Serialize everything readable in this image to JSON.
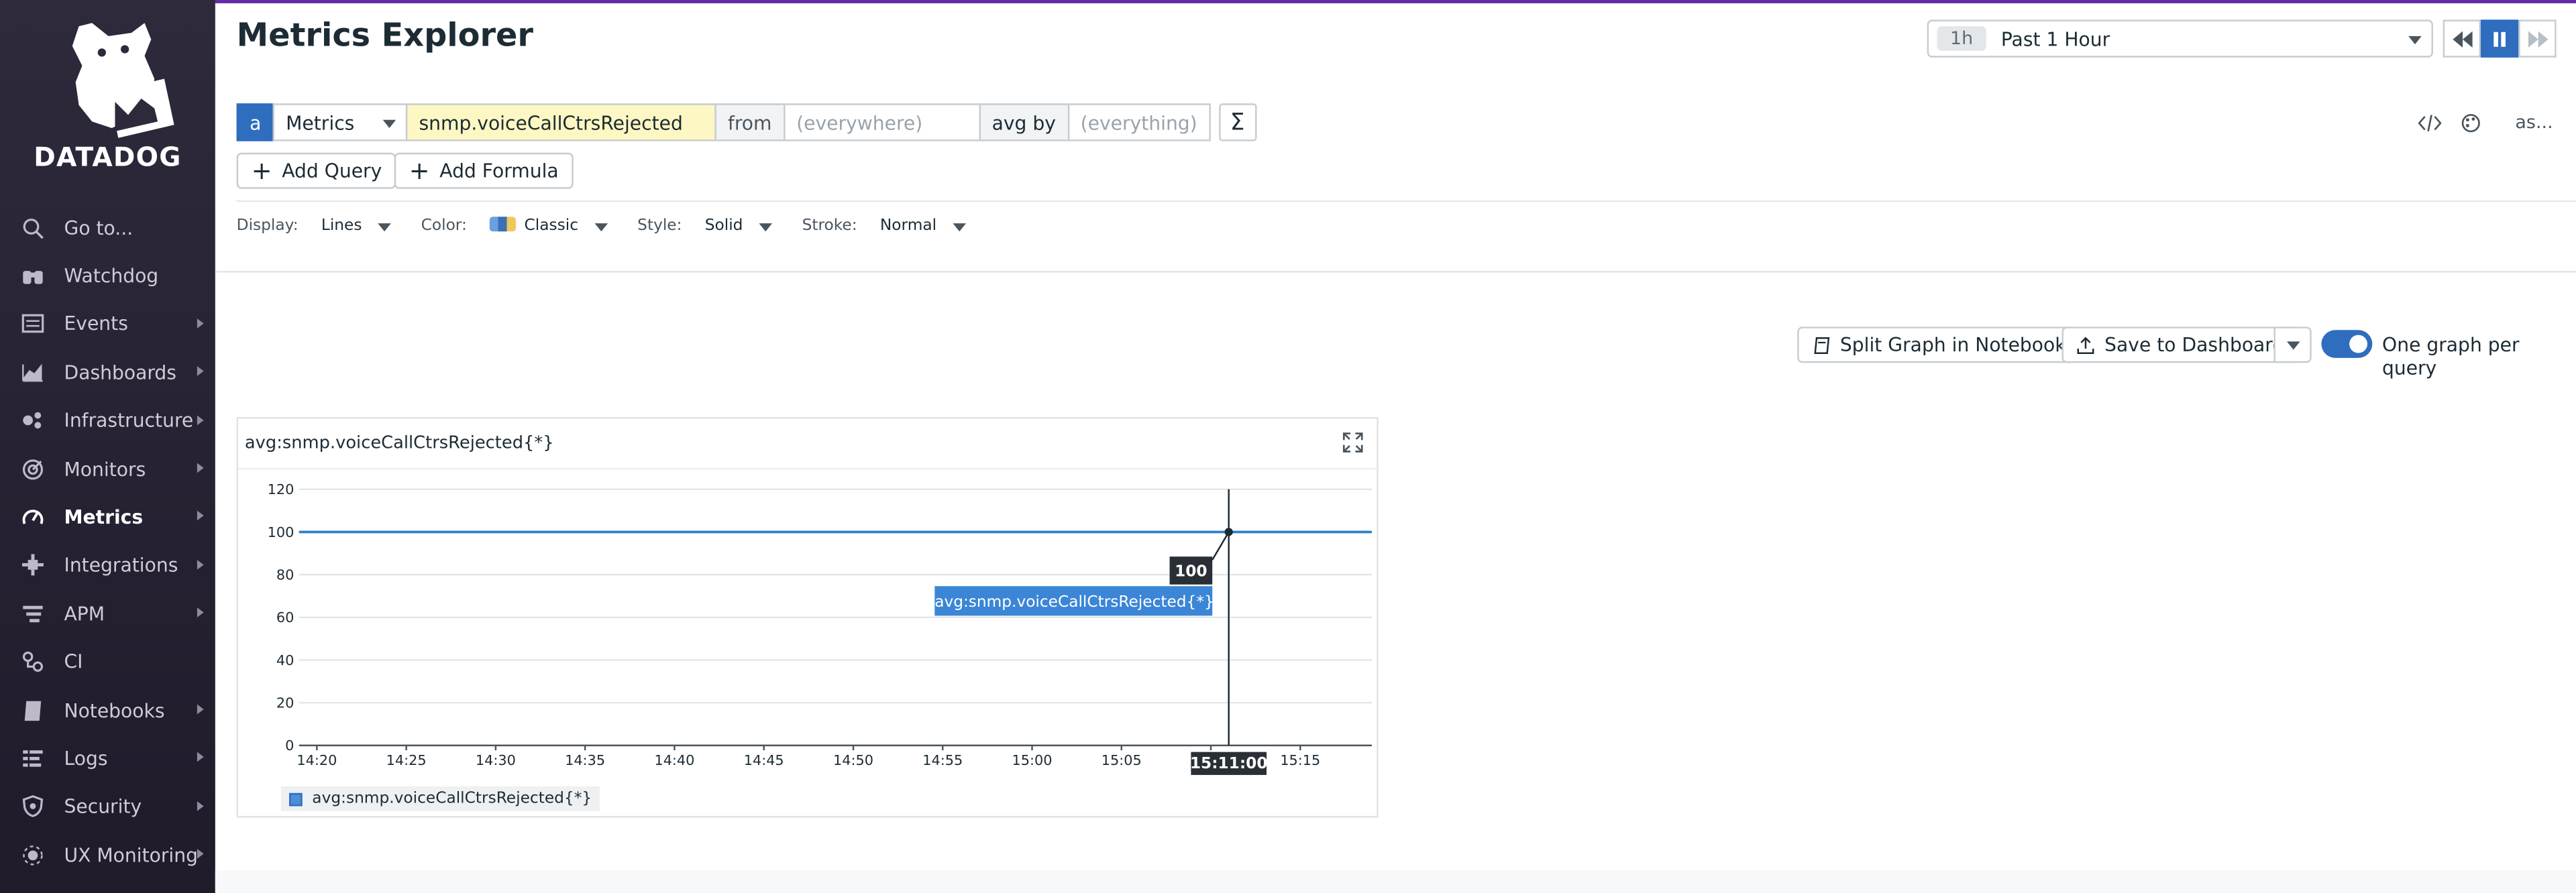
{
  "brand": {
    "name": "DATADOG",
    "accent": "#632ca6",
    "primary": "#2f6dbf"
  },
  "sidebar": {
    "items": [
      {
        "label": "Go to...",
        "icon": "search-icon",
        "arrow": false
      },
      {
        "label": "Watchdog",
        "icon": "binoculars-icon",
        "arrow": false
      },
      {
        "label": "Events",
        "icon": "events-icon",
        "arrow": true
      },
      {
        "label": "Dashboards",
        "icon": "dashboards-icon",
        "arrow": true
      },
      {
        "label": "Infrastructure",
        "icon": "infrastructure-icon",
        "arrow": true
      },
      {
        "label": "Monitors",
        "icon": "monitors-icon",
        "arrow": true
      },
      {
        "label": "Metrics",
        "icon": "metrics-icon",
        "arrow": true,
        "active": true
      },
      {
        "label": "Integrations",
        "icon": "integrations-icon",
        "arrow": true
      },
      {
        "label": "APM",
        "icon": "apm-icon",
        "arrow": true
      },
      {
        "label": "CI",
        "icon": "ci-icon",
        "arrow": false
      },
      {
        "label": "Notebooks",
        "icon": "notebook-icon",
        "arrow": true
      },
      {
        "label": "Logs",
        "icon": "logs-icon",
        "arrow": true
      },
      {
        "label": "Security",
        "icon": "shield-icon",
        "arrow": true
      },
      {
        "label": "UX Monitoring",
        "icon": "ux-icon",
        "arrow": true
      }
    ]
  },
  "header": {
    "title": "Metrics Explorer",
    "time_pill": "1h",
    "time_label": "Past 1 Hour"
  },
  "query": {
    "letter": "a",
    "type": "Metrics",
    "metric": "snmp.voiceCallCtrsRejected",
    "from_label": "from",
    "from_placeholder": "(everywhere)",
    "avgby_label": "avg by",
    "avgby_placeholder": "(everything)",
    "sigma": "Σ",
    "more": "as..."
  },
  "buttons": {
    "add_query": "Add Query",
    "add_formula": "Add Formula",
    "split_graph": "Split Graph in Notebook",
    "save_dashboard": "Save to Dashboard",
    "one_graph": "One graph per query"
  },
  "display": {
    "display_label": "Display:",
    "display_value": "Lines",
    "color_label": "Color:",
    "color_value": "Classic",
    "style_label": "Style:",
    "style_value": "Solid",
    "stroke_label": "Stroke:",
    "stroke_value": "Normal"
  },
  "graph": {
    "title": "avg:snmp.voiceCallCtrsRejected{*}",
    "tooltip_value": "100",
    "tooltip_series": "avg:snmp.voiceCallCtrsRejected{*}",
    "cursor_time": "15:11:00",
    "legend": "avg:snmp.voiceCallCtrsRejected{*}"
  },
  "chart_data": {
    "type": "line",
    "title": "avg:snmp.voiceCallCtrsRejected{*}",
    "x_ticks": [
      "14:20",
      "14:25",
      "14:30",
      "14:35",
      "14:40",
      "14:45",
      "14:50",
      "14:55",
      "15:00",
      "15:05",
      "15:10",
      "15:15"
    ],
    "y_ticks": [
      0,
      20,
      40,
      60,
      80,
      100,
      120
    ],
    "ylim": [
      0,
      120
    ],
    "xlim": [
      "14:19",
      "15:19"
    ],
    "series": [
      {
        "name": "avg:snmp.voiceCallCtrsRejected{*}",
        "color": "#2f7fc7",
        "x": [
          "14:19",
          "15:19"
        ],
        "values": [
          100,
          100
        ]
      }
    ],
    "cursor": {
      "x": "15:11",
      "y": 100
    },
    "grid": true
  }
}
